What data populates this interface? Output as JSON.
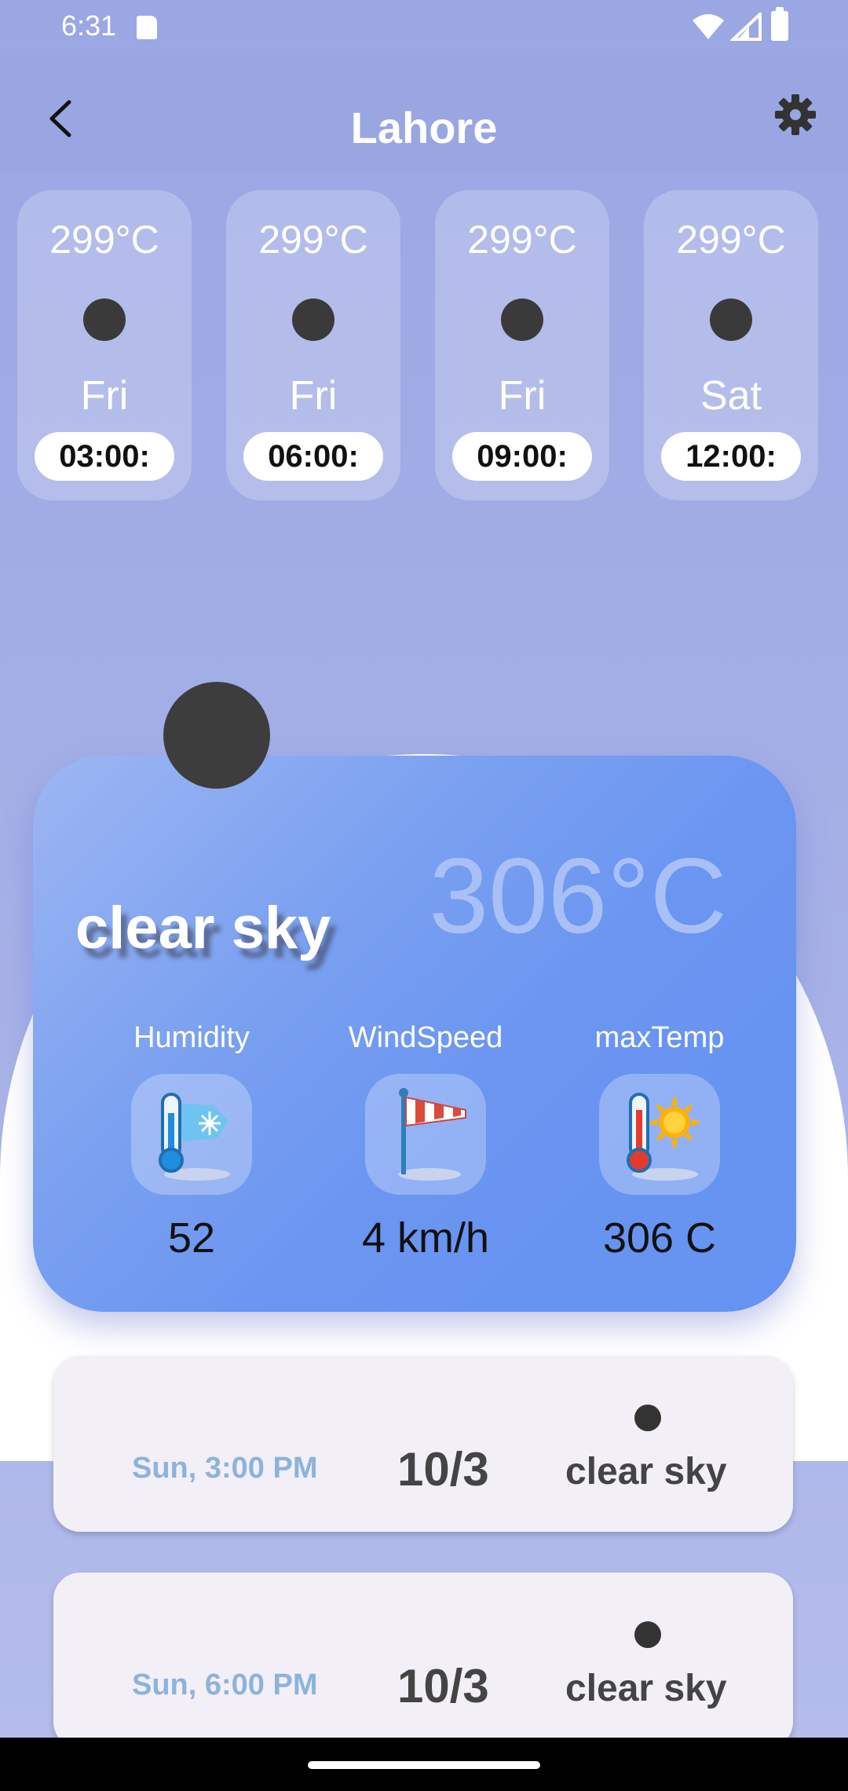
{
  "status_bar": {
    "time": "6:31"
  },
  "header": {
    "title": "Lahore"
  },
  "hourly": [
    {
      "temp": "299°C",
      "day": "Fri",
      "time": "03:00:"
    },
    {
      "temp": "299°C",
      "day": "Fri",
      "time": "06:00:"
    },
    {
      "temp": "299°C",
      "day": "Fri",
      "time": "09:00:"
    },
    {
      "temp": "299°C",
      "day": "Sat",
      "time": "12:00:"
    }
  ],
  "current": {
    "temp": "306°C",
    "description": "clear sky",
    "stats": [
      {
        "label": "Humidity",
        "value": "52",
        "icon": "humidity-thermometer-icon"
      },
      {
        "label": "WindSpeed",
        "value": "4 km/h",
        "icon": "windsock-icon"
      },
      {
        "label": "maxTemp",
        "value": "306 C",
        "icon": "thermometer-sun-icon"
      }
    ]
  },
  "daily": [
    {
      "date": "Sun, 3:00 PM",
      "value": "10/3",
      "description": "clear sky"
    },
    {
      "date": "Sun, 6:00 PM",
      "value": "10/3",
      "description": "clear sky"
    }
  ],
  "colors": {
    "background": "#9aa6e2",
    "card_gradient_start": "#9db6f3",
    "card_gradient_end": "#6693f1",
    "date_text": "#8cb3db"
  }
}
